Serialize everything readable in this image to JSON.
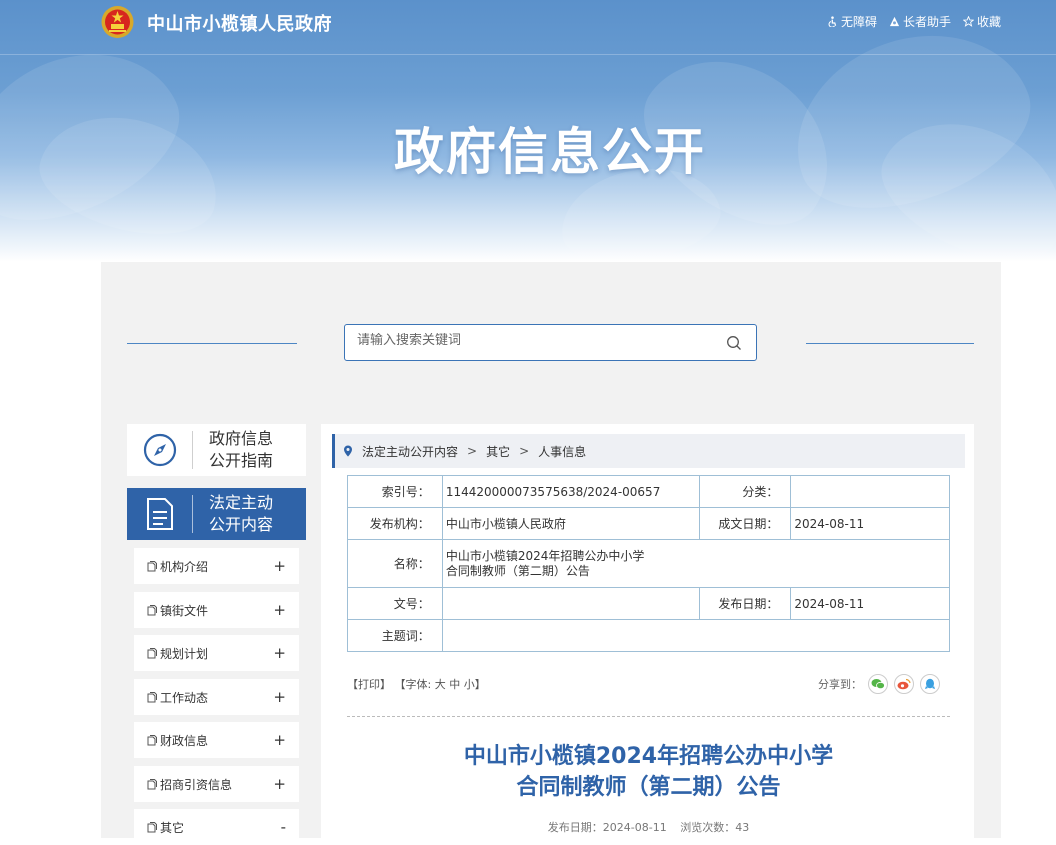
{
  "header": {
    "site_name": "中山市小榄镇人民政府",
    "tools": [
      {
        "label": "无障碍",
        "icon": "accessibility-icon"
      },
      {
        "label": "长者助手",
        "icon": "elder-helper-icon"
      },
      {
        "label": "收藏",
        "icon": "star-icon"
      }
    ]
  },
  "banner": {
    "title": "政府信息公开"
  },
  "search": {
    "placeholder": "请输入搜索关键词",
    "icon": "search-icon"
  },
  "sidebar": {
    "guide": {
      "label_line1": "政府信息",
      "label_line2": "公开指南",
      "icon": "compass-icon"
    },
    "active": {
      "label_line1": "法定主动",
      "label_line2": "公开内容",
      "icon": "document-icon"
    },
    "items": [
      {
        "label": "机构介绍",
        "toggle": "+"
      },
      {
        "label": "镇街文件",
        "toggle": "+"
      },
      {
        "label": "规划计划",
        "toggle": "+"
      },
      {
        "label": "工作动态",
        "toggle": "+"
      },
      {
        "label": "财政信息",
        "toggle": "+"
      },
      {
        "label": "招商引资信息",
        "toggle": "+"
      },
      {
        "label": "其它",
        "toggle": "-"
      }
    ]
  },
  "breadcrumb": {
    "items": [
      "法定主动公开内容",
      "其它",
      "人事信息"
    ]
  },
  "info_table": {
    "index_label": "索引号：",
    "index_value": "114420000073575638/2024-00657",
    "category_label": "分类：",
    "category_value": "",
    "publisher_label": "发布机构：",
    "publisher_value": "中山市小榄镇人民政府",
    "created_label": "成文日期：",
    "created_value": "2024-08-11",
    "name_label": "名称：",
    "name_line1": "中山市小榄镇2024年招聘公办中小学",
    "name_line2": "合同制教师（第二期）公告",
    "docno_label": "文号：",
    "docno_value": "",
    "published_label": "发布日期：",
    "published_value": "2024-08-11",
    "keywords_label": "主题词：",
    "keywords_value": ""
  },
  "toolbar": {
    "print": "【打印】",
    "font_prefix": "【字体:",
    "font_large": "大",
    "font_medium": "中",
    "font_small": "小",
    "font_suffix": "】",
    "share_label": "分享到："
  },
  "share_colors": {
    "wechat": "#54b548",
    "weibo": "#e8563b",
    "qq": "#3aa0e0"
  },
  "article": {
    "title_line1": "中山市小榄镇2024年招聘公办中小学",
    "title_line2": "合同制教师（第二期）公告",
    "meta_date_label": "发布日期：",
    "meta_date": "2024-08-11",
    "meta_views_label": "浏览次数：",
    "meta_views": "43"
  }
}
